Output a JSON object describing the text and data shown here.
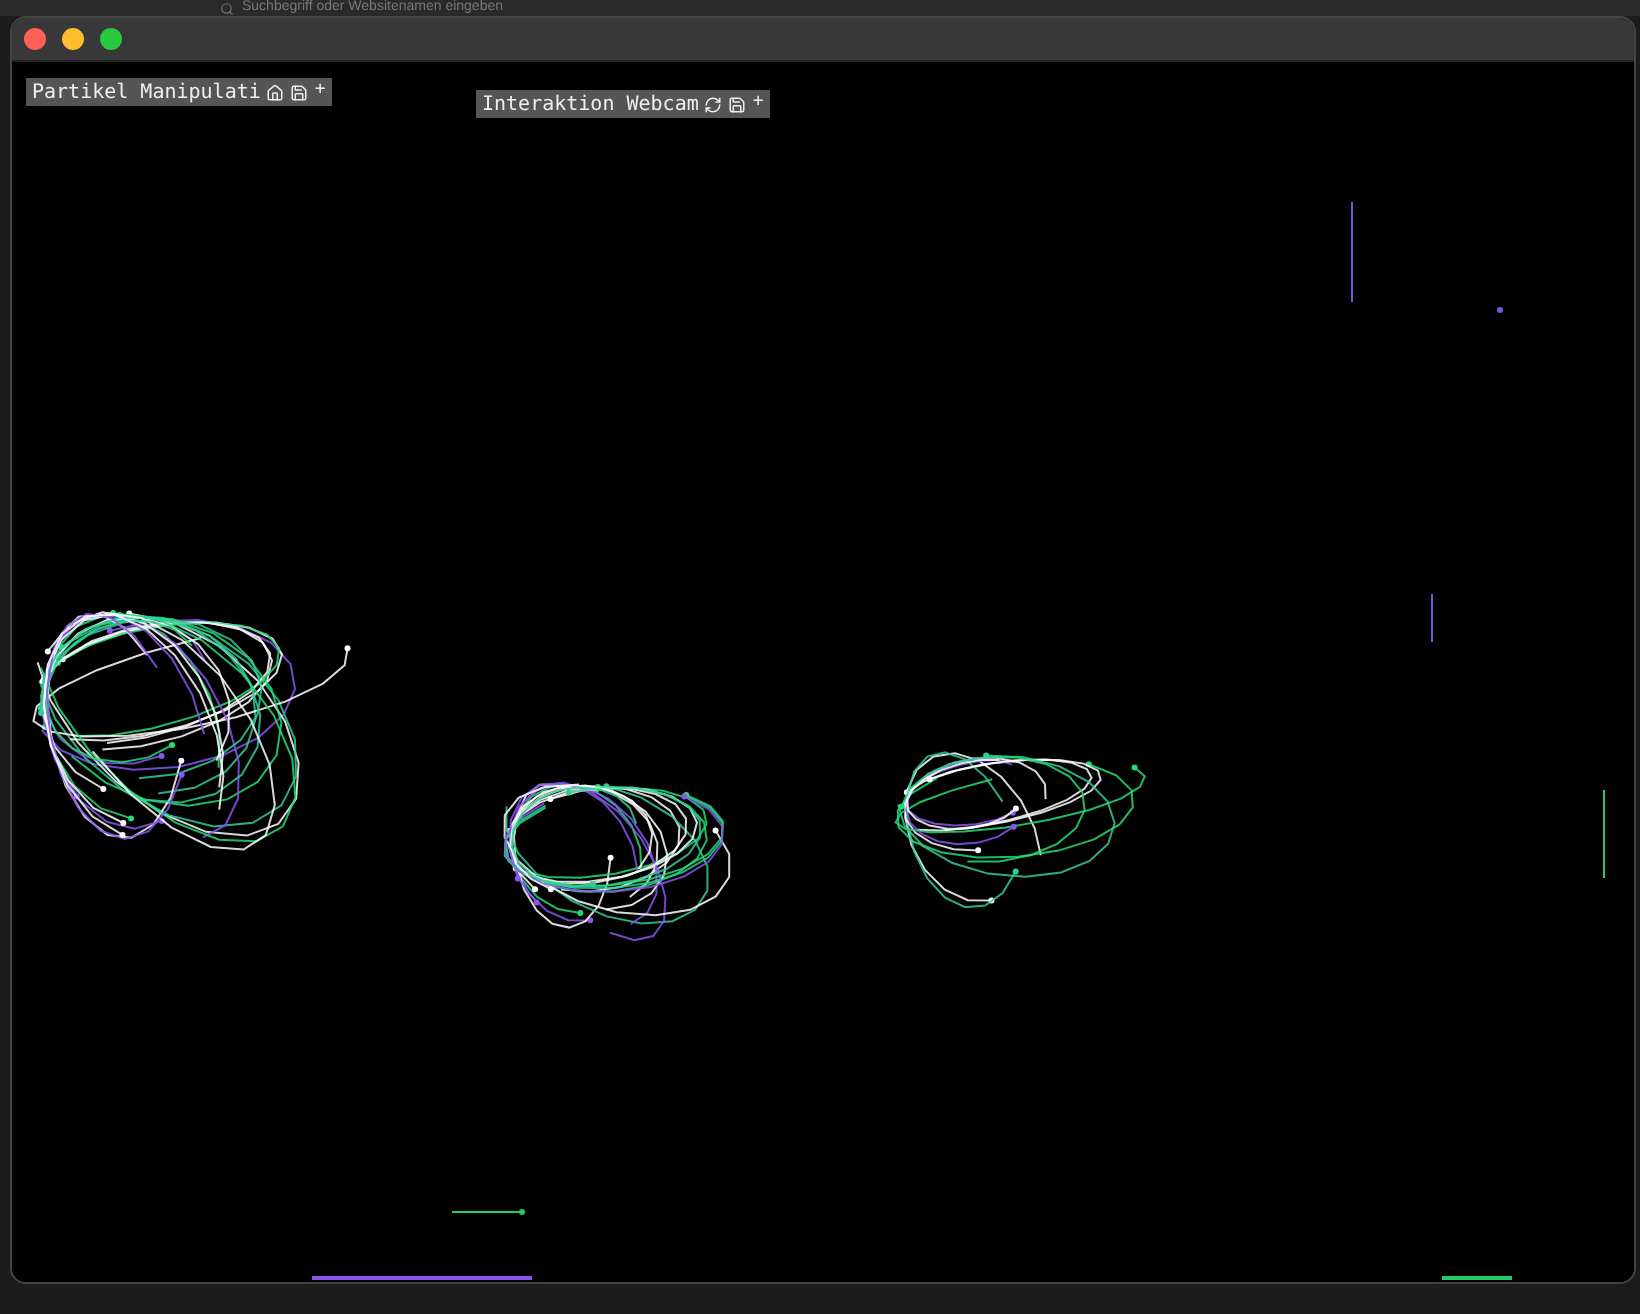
{
  "browser": {
    "search_placeholder": "Suchbegriff oder Websitenamen eingeben"
  },
  "panels": [
    {
      "title": "Partikel Manipulati",
      "plus": "+"
    },
    {
      "title": "Interaktion Webcam",
      "plus": "+"
    }
  ]
}
